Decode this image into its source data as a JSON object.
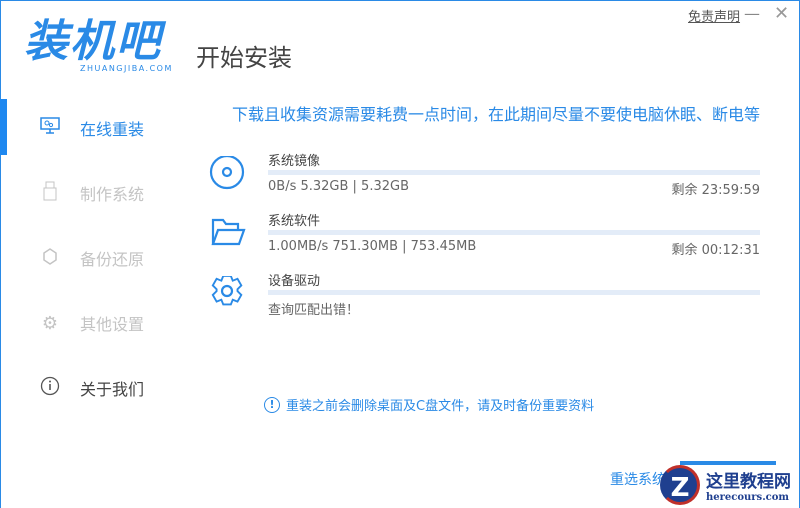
{
  "app": {
    "logo_cn": "装机吧",
    "logo_en": "ZHUANGJIBA.COM",
    "title": "开始安装",
    "disclaimer": "免责声明",
    "minimize": "—",
    "close": "✕"
  },
  "sidebar": {
    "items": [
      {
        "label": "在线重装",
        "icon": "monitor-icon",
        "active": true
      },
      {
        "label": "制作系统",
        "icon": "usb-icon",
        "active": false
      },
      {
        "label": "备份还原",
        "icon": "backup-icon",
        "active": false
      },
      {
        "label": "其他设置",
        "icon": "gear-icon",
        "active": false
      },
      {
        "label": "关于我们",
        "icon": "info-icon",
        "active": false
      }
    ]
  },
  "main": {
    "notice": "下载且收集资源需要耗费一点时间，在此期间尽量不要使电脑休眠、断电等",
    "items": [
      {
        "name": "系统镜像",
        "icon": "disc-icon",
        "info": "0B/s 5.32GB | 5.32GB",
        "remain": "剩余 23:59:59",
        "progress": 0
      },
      {
        "name": "系统软件",
        "icon": "folder-icon",
        "info": "1.00MB/s 751.30MB | 753.45MB",
        "remain": "剩余 00:12:31",
        "progress": 0
      },
      {
        "name": "设备驱动",
        "icon": "gear-icon",
        "info": "查询匹配出错！",
        "remain": "",
        "progress": 0
      }
    ],
    "tip": "重装之前会删除桌面及C盘文件，请及时备份重要资料",
    "tip_icon": "!",
    "reselect": "重选系统"
  },
  "watermark": {
    "title": "这里教程网",
    "url": "herecours.com",
    "letter": "Z"
  },
  "colors": {
    "accent": "#2a8ae6",
    "inactive": "#c4c4c4"
  }
}
